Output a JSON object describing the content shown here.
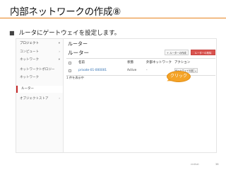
{
  "slide": {
    "title": "内部ネットワークの作成⑧",
    "bullet": "ルータにゲートウェイを設定します。",
    "footer": "redhat",
    "page_number": "38"
  },
  "sidebar": {
    "items": [
      {
        "label": "プロジェクト",
        "chevron": "▾"
      },
      {
        "label": "コンピュート",
        "chevron": "›"
      },
      {
        "label": "ネットワーク",
        "chevron": "▾"
      },
      {
        "label": "ネットワークトポロジー"
      },
      {
        "label": "ネットワーク"
      },
      {
        "label": "ルーター"
      },
      {
        "label": "オブジェクトストア",
        "chevron": "›"
      }
    ]
  },
  "main": {
    "breadcrumb": "ルーター",
    "title": "ルーター",
    "create_button": "+ ルーターの作成",
    "delete_button": "ルーターの削除",
    "table": {
      "headers": [
        "名前",
        "状態",
        "外部ネットワーク",
        "アクション"
      ],
      "rows": [
        {
          "name": "private-01-000001",
          "status": "Active",
          "external_network": "-",
          "action": "ゲートウェイの設定"
        }
      ],
      "footer": "1 件を表示中"
    }
  },
  "callout": {
    "text": "クリック",
    "color": "#f4a327"
  },
  "colors": {
    "accent_rule": "#e8821e",
    "danger": "#d9534f",
    "active_marker": "#c62828",
    "link": "#2a6cb0"
  }
}
